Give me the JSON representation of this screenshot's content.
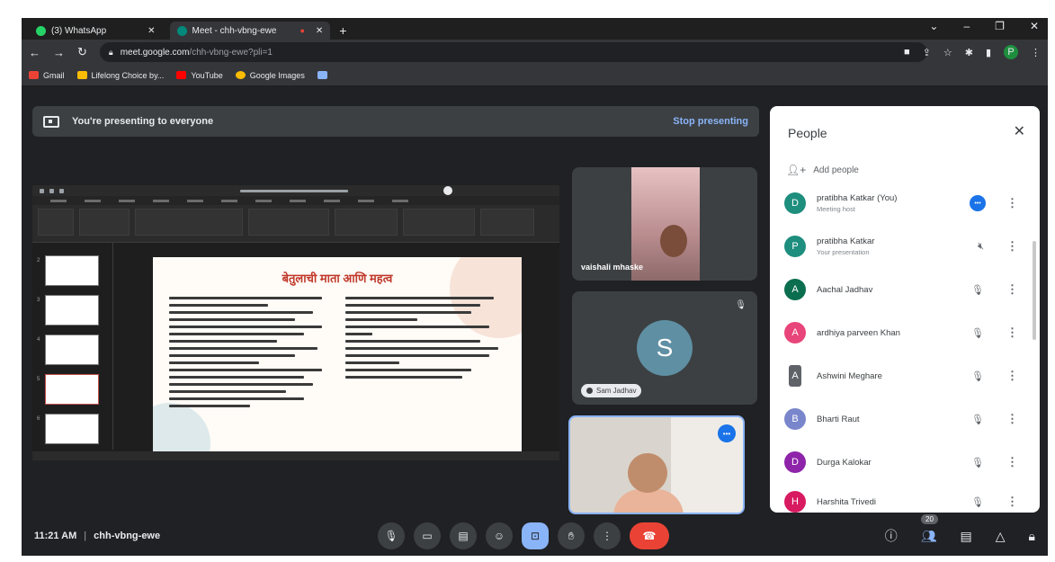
{
  "browser": {
    "tabs": [
      {
        "label": "(3) WhatsApp",
        "color": "#25d366",
        "active": false
      },
      {
        "label": "Meet - chh-vbng-ewe",
        "color": "#00897b",
        "active": true
      }
    ],
    "url_host": "meet.google.com",
    "url_path": "/chh-vbng-ewe?pli=1",
    "bookmarks": [
      {
        "label": "Gmail",
        "color": "#ea4335"
      },
      {
        "label": "Lifelong Choice by...",
        "color": "#fbbc04"
      },
      {
        "label": "YouTube",
        "color": "#ff0000"
      },
      {
        "label": "Google Images",
        "color": "#fbbc04"
      }
    ],
    "profile_initial": "P"
  },
  "banner": {
    "text": "You're presenting to everyone",
    "stop_label": "Stop presenting"
  },
  "slide": {
    "title": "बेतुलाची माता आणि महत्व"
  },
  "tiles": {
    "tile1_name": "vaishali mhaske",
    "tile2_initial": "S",
    "tile2_name": "Sam Jadhav"
  },
  "people": {
    "title": "People",
    "add_label": "Add people",
    "rows": [
      {
        "initial": "D",
        "color": "#1e8e7e",
        "name": "pratibha Katkar (You)",
        "sub": "Meeting host",
        "mic": "speaking"
      },
      {
        "initial": "P",
        "color": "#1e8e7e",
        "name": "pratibha Katkar",
        "sub": "Your presentation",
        "mic": "off"
      },
      {
        "initial": "A",
        "color": "#0b6e4f",
        "name": "Aachal Jadhav",
        "sub": "",
        "mic": "off"
      },
      {
        "initial": "A",
        "color": "#e8457a",
        "name": "ardhiya parveen Khan",
        "sub": "",
        "mic": "off"
      },
      {
        "initial": "A",
        "color": "#5f6368",
        "name": "Ashwini Meghare",
        "sub": "",
        "mic": "off"
      },
      {
        "initial": "B",
        "color": "#7986cb",
        "name": "Bharti Raut",
        "sub": "",
        "mic": "off"
      },
      {
        "initial": "D",
        "color": "#8e24aa",
        "name": "Durga Kalokar",
        "sub": "",
        "mic": "off"
      },
      {
        "initial": "H",
        "color": "#d81b60",
        "name": "Harshita Trivedi",
        "sub": "",
        "mic": "off"
      }
    ]
  },
  "bottom": {
    "time": "11:21 AM",
    "separator": "|",
    "meeting_code": "chh-vbng-ewe",
    "participant_count": "20"
  }
}
